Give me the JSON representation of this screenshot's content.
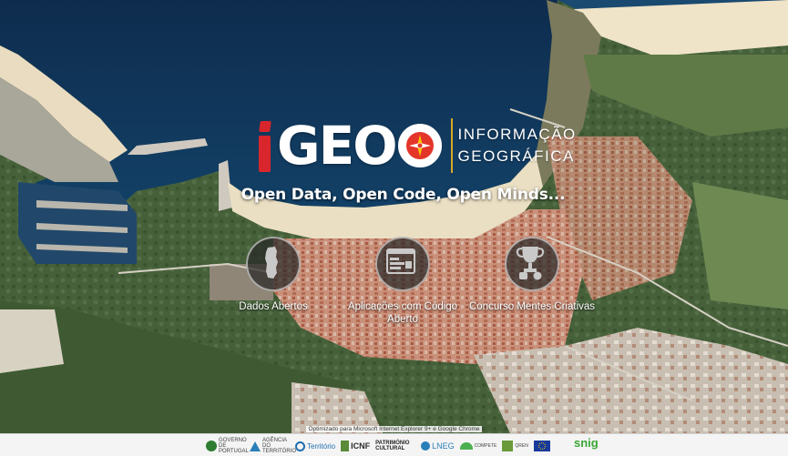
{
  "logo": {
    "i": "i",
    "geo": "GEO",
    "line1": "INFORMAÇÃO",
    "line2": "GEOGRÁFICA"
  },
  "tagline": "Open Data, Open Code, Open Minds...",
  "features": [
    {
      "label": "Dados Abertos",
      "icon": "portugal-map-icon"
    },
    {
      "label": "Aplicações com Código Aberto",
      "icon": "code-window-icon"
    },
    {
      "label": "Concurso Mentes Criativas",
      "icon": "trophy-icon"
    }
  ],
  "footer": {
    "optimized_text": "Optimizado para Microsoft Internet Explorer 9+ e Google Chrome",
    "partners": [
      {
        "name": "GOVERNO DE PORTUGAL",
        "color": "#2e7d32"
      },
      {
        "name": "AGÊNCIA DO TERRITÓRIO",
        "color": "#2a7fb8"
      },
      {
        "name": "Território",
        "color": "#1f6fb0"
      },
      {
        "name": "ICNF",
        "color": "#2b2b2b"
      },
      {
        "name": "PATRIMÓNIO CULTURAL",
        "color": "#222222"
      },
      {
        "name": "LNEG",
        "color": "#2a7fb8"
      },
      {
        "name": "COMPETE",
        "color": "#4caf50"
      },
      {
        "name": "QREN",
        "color": "#6a9a3a"
      },
      {
        "name": "EU",
        "color": "#1a3a9a"
      }
    ],
    "snig": "snig"
  },
  "colors": {
    "accent_red": "#d8262c",
    "gold": "#d9a722",
    "snig_green": "#3aa535"
  }
}
